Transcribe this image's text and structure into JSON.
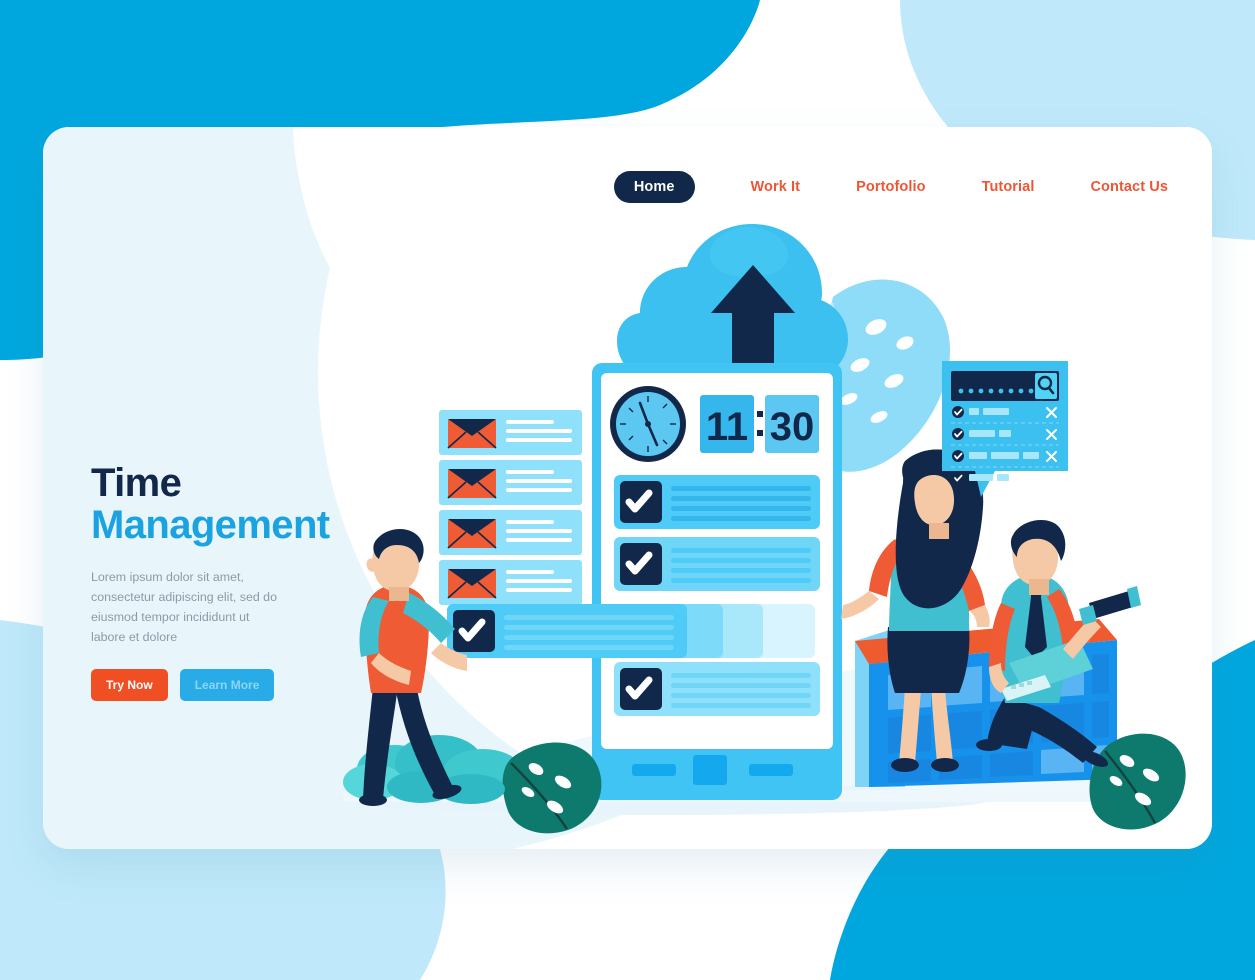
{
  "page": {
    "title": "Time Management Landing Page",
    "background_color": "#00a7de",
    "card_color": "#e8f6fc"
  },
  "nav": {
    "items": [
      {
        "label": "Home",
        "active": true
      },
      {
        "label": "Work It",
        "active": false
      },
      {
        "label": "Portofolio",
        "active": false
      },
      {
        "label": "Tutorial",
        "active": false
      },
      {
        "label": "Contact Us",
        "active": false
      }
    ],
    "active_bg": "#12284a",
    "link_color": "#ee5635"
  },
  "hero": {
    "title_line1": "Time",
    "title_line2": "Management",
    "title_color1": "#12284a",
    "title_color2": "#1ba2e0",
    "body": "Lorem ipsum dolor sit amet, consectetur adipiscing elit, sed do eiusmod tempor incididunt ut labore et dolore",
    "buttons": [
      {
        "label": "Try Now",
        "bg": "#f04f23",
        "fg": "#ffffff"
      },
      {
        "label": "Learn More",
        "bg": "#29abe8",
        "fg": "#8ed4f3"
      }
    ]
  },
  "illustration": {
    "cloud_upload": {
      "name": "cloud-upload-icon",
      "cloud_color": "#3cc0f0",
      "arrow_color": "#12284a"
    },
    "clock": {
      "digital_time": "11 : 30",
      "hours": "11",
      "separator": ":",
      "minutes": "30",
      "analog_face_color": "#5cc8f2",
      "analog_rim_color": "#12284a",
      "tile_color": "#35b6ec",
      "digit_color": "#12284a"
    },
    "email_list": {
      "count": 4,
      "row_color": "#8fe0fa",
      "envelope_body": "#ef5b34",
      "envelope_flap": "#12284a",
      "line_color": "#ffffff"
    },
    "task_list": {
      "checkbox_color": "#12284a",
      "check_color": "#ffffff",
      "row_color": "#4ecbf7",
      "rows": [
        {
          "state": "checked"
        },
        {
          "state": "checked"
        },
        {
          "state": "dragging"
        },
        {
          "state": "checked"
        }
      ]
    },
    "popup": {
      "name": "search-popup",
      "bubble_color": "#3cc0f0",
      "searchbar_color": "#12284a",
      "search_button_color": "#4fd4f5",
      "search_icon": "magnifier-icon",
      "masked_dots": 9,
      "rows": [
        {
          "checked": true,
          "pills": [
            1,
            3
          ],
          "delete_icon": "close-icon"
        },
        {
          "checked": true,
          "pills": [
            3,
            1
          ],
          "delete_icon": "close-icon"
        },
        {
          "checked": true,
          "pills": [
            2,
            3,
            2
          ],
          "delete_icon": "close-icon"
        },
        {
          "checked": true,
          "pills": [
            3,
            1
          ],
          "delete_icon": "close-icon"
        }
      ]
    },
    "calendar": {
      "header_color": "#ee5b2f",
      "body_color": "#1792ec",
      "side_color": "#7fd3f6",
      "rows": 3,
      "cols": 5
    },
    "device_nav": {
      "buttons": [
        "back-bar",
        "home-square",
        "recents-bar"
      ],
      "bar_color": "#40c4f4",
      "button_color": "#14a9ef"
    },
    "characters": [
      {
        "name": "man-dragging-task",
        "shirt": "#ef5b34",
        "sleeve": "#3fbfcf",
        "pants": "#12284a"
      },
      {
        "name": "woman-standing",
        "top": "#3fbfcf",
        "sleeve": "#ef5b34",
        "skirt": "#12284a",
        "hair": "#12284a"
      },
      {
        "name": "man-with-telescope",
        "vest": "#3fbfcf",
        "shirt": "#ef5b34",
        "tie": "#12284a",
        "pants": "#12284a"
      }
    ],
    "plants": [
      {
        "name": "monstera-leaf-light",
        "color": "#8fdcf8"
      },
      {
        "name": "monstera-leaf-dark-left",
        "color": "#0e7a6e"
      },
      {
        "name": "monstera-leaf-dark-right",
        "color": "#0e7a6e"
      },
      {
        "name": "bush-teal",
        "color": "#3fc9cf"
      }
    ]
  }
}
